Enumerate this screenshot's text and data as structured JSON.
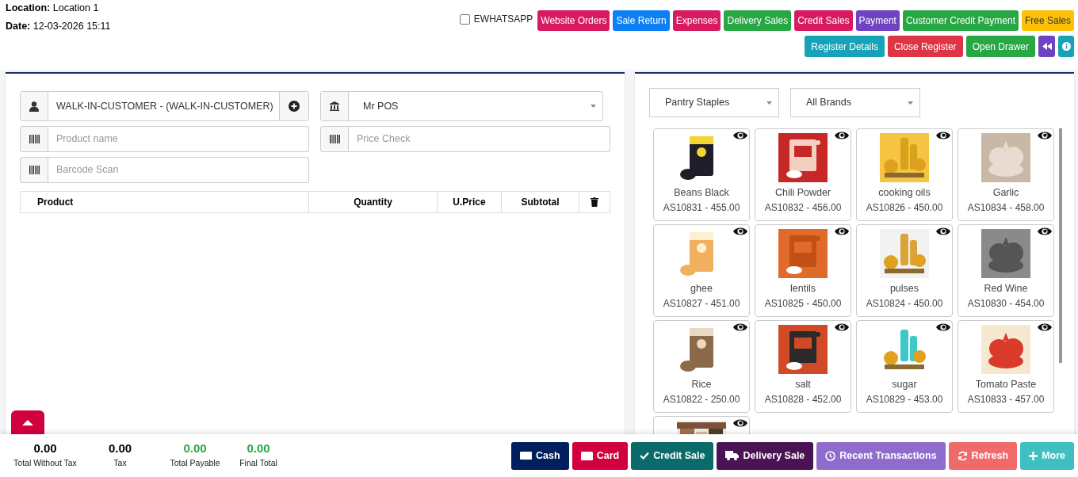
{
  "header": {
    "location_label": "Location:",
    "location": "Location 1",
    "date_label": "Date:",
    "date": "12-03-2026 15:11"
  },
  "whatsapp": {
    "label": "EWHATSAPP",
    "checked": false
  },
  "top_buttons": [
    {
      "label": "Website Orders",
      "color": "#d81b60"
    },
    {
      "label": "Sale Return",
      "color": "#0d7ff5"
    },
    {
      "label": "Expenses",
      "color": "#d81b60"
    },
    {
      "label": "Delivery Sales",
      "color": "#28a745"
    },
    {
      "label": "Credit Sales",
      "color": "#d81b60"
    },
    {
      "label": "Payment",
      "color": "#6f42c1"
    },
    {
      "label": "Customer Credit Payment",
      "color": "#28a745"
    },
    {
      "label": "Free Sales",
      "color": "#ffc107"
    }
  ],
  "register_buttons": [
    {
      "label": "Register Details",
      "color": "#17a2b8"
    },
    {
      "label": "Close Register",
      "color": "#dc3545"
    },
    {
      "label": "Open Drawer",
      "color": "#28a745"
    }
  ],
  "customer": {
    "value": "WALK-IN-CUSTOMER - (WALK-IN-CUSTOMER)"
  },
  "employee": {
    "value": "Mr POS"
  },
  "product_search": {
    "placeholder": "Product name"
  },
  "price_check": {
    "placeholder": "Price Check"
  },
  "barcode": {
    "placeholder": "Barcode Scan"
  },
  "table": {
    "columns": [
      "Product",
      "Quantity",
      "U.Price",
      "Subtotal"
    ]
  },
  "category_select": {
    "value": "Pantry Staples"
  },
  "brand_select": {
    "value": "All Brands"
  },
  "products": [
    {
      "kind": "product",
      "name": "Beans Black",
      "code_price": "AS10831 - 455.00"
    },
    {
      "kind": "product",
      "name": "Chili Powder",
      "code_price": "AS10832 - 456.00"
    },
    {
      "kind": "product",
      "name": "cooking oils",
      "code_price": "AS10826 - 450.00"
    },
    {
      "kind": "product",
      "name": "Garlic",
      "code_price": "AS10834 - 458.00"
    },
    {
      "kind": "product",
      "name": "ghee",
      "code_price": "AS10827 - 451.00"
    },
    {
      "kind": "product",
      "name": "lentils",
      "code_price": "AS10825 - 450.00"
    },
    {
      "kind": "product",
      "name": "pulses",
      "code_price": "AS10824 - 450.00"
    },
    {
      "kind": "product",
      "name": "Red Wine",
      "code_price": "AS10830 - 454.00"
    },
    {
      "kind": "product",
      "name": "Rice",
      "code_price": "AS10822 - 250.00"
    },
    {
      "kind": "product",
      "name": "salt",
      "code_price": "AS10828 - 452.00"
    },
    {
      "kind": "product",
      "name": "sugar",
      "code_price": "AS10829 - 453.00"
    },
    {
      "kind": "product",
      "name": "Tomato Paste",
      "code_price": "AS10833 - 457.00"
    },
    {
      "kind": "picture"
    }
  ],
  "totals": [
    {
      "value": "0.00",
      "label": "Total Without Tax",
      "color": "#000000"
    },
    {
      "value": "0.00",
      "label": "Tax",
      "color": "#000000"
    },
    {
      "value": "0.00",
      "label": "Total Payable",
      "color": "#28a745"
    },
    {
      "value": "0.00",
      "label": "Final Total",
      "color": "#28a745"
    }
  ],
  "actions": [
    {
      "label": "Cash",
      "kind": "cash",
      "color": "#001f5c"
    },
    {
      "label": "Card",
      "kind": "card",
      "color": "#d1003f"
    },
    {
      "label": "Credit Sale",
      "kind": "check",
      "color": "#0b6b6b"
    },
    {
      "label": "Delivery Sale",
      "kind": "truck",
      "color": "#4a1454"
    },
    {
      "label": "Recent Transactions",
      "kind": "clock",
      "color": "#8e6ccd"
    },
    {
      "label": "Refresh",
      "kind": "refresh",
      "color": "#f06a6a"
    },
    {
      "label": "More",
      "kind": "plus",
      "color": "#3fc0c0"
    }
  ]
}
